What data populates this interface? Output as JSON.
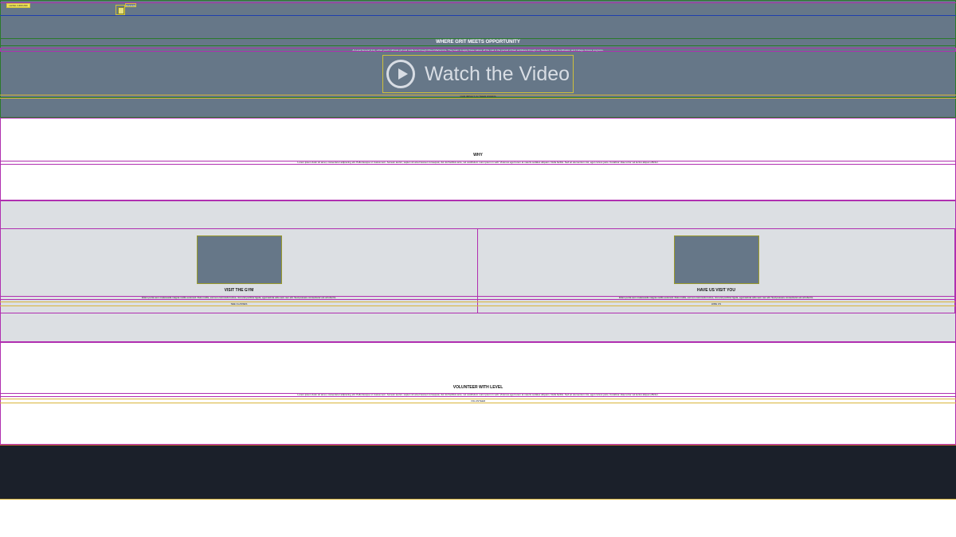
{
  "header": {
    "logo_text": "LEVEL GROUND",
    "donate_label": "DONATE"
  },
  "hero": {
    "title": "WHERE GRIT MEETS OPPORTUNITY",
    "subtitle": "At Level Ground (LG), urban youth cultivate grit and resilience through Mixed Martial Arts. They learn to apply these values off the mat in the pursuit of their ambitions through our Student Trainer Certification and College Access programs.",
    "video_label": "Watch the Video",
    "caption": "OUR IMPACT, IN THEIR WORDS"
  },
  "why": {
    "title": "WHY",
    "text": "Lorem ipsum dolor sit amet, consectetur adipiscing elit. Pellentesque ut massa sem. Aenean auctor, sapien sit amet laoreet consequat, dui nisl facilisis ante, vel vestibulum nunc ipsum in velit. Vivamus eget lorem at mauris sodales aliquam. Nulla facilisi. Sed ac elementum nisi, eget cursus justo. Curabitur vitae tortor vel lectus aliquet efficitur."
  },
  "cards": [
    {
      "title": "VISIT THE GYM",
      "text": "Etiam porta sem malesuada magna mollis euismod. Duis mollis, est non commodo luctus, nisi erat porttitor ligula, eget lacinia odio sem nec elit. Sed posuere consectetur est at lobortis.",
      "button": "SEE CLASSES"
    },
    {
      "title": "HAVE US VISIT YOU",
      "text": "Etiam porta sem malesuada magna mollis euismod. Duis mollis, est non commodo luctus, nisi erat porttitor ligula, eget lacinia odio sem nec elit. Sed posuere consectetur est at lobortis.",
      "button": "HIRE US"
    }
  ],
  "volunteer": {
    "title": "VOLUNTEER WITH LEVEL",
    "text": "Lorem ipsum dolor sit amet, consectetur adipiscing elit. Pellentesque ut massa sem. Aenean auctor, sapien sit amet laoreet consequat, dui nisl facilisis ante, vel vestibulum nunc ipsum in velit. Vivamus eget lorem at mauris sodales aliquam. Nulla facilisi. Sed ac elementum nisi, eget cursus justo. Curabitur vitae tortor vel lectus aliquet efficitur.",
    "button": "VOLUNTEER"
  },
  "colors": {
    "hero_bg": "#667788",
    "section_gray": "#dcdfe3",
    "footer_bg": "#1b202a"
  }
}
